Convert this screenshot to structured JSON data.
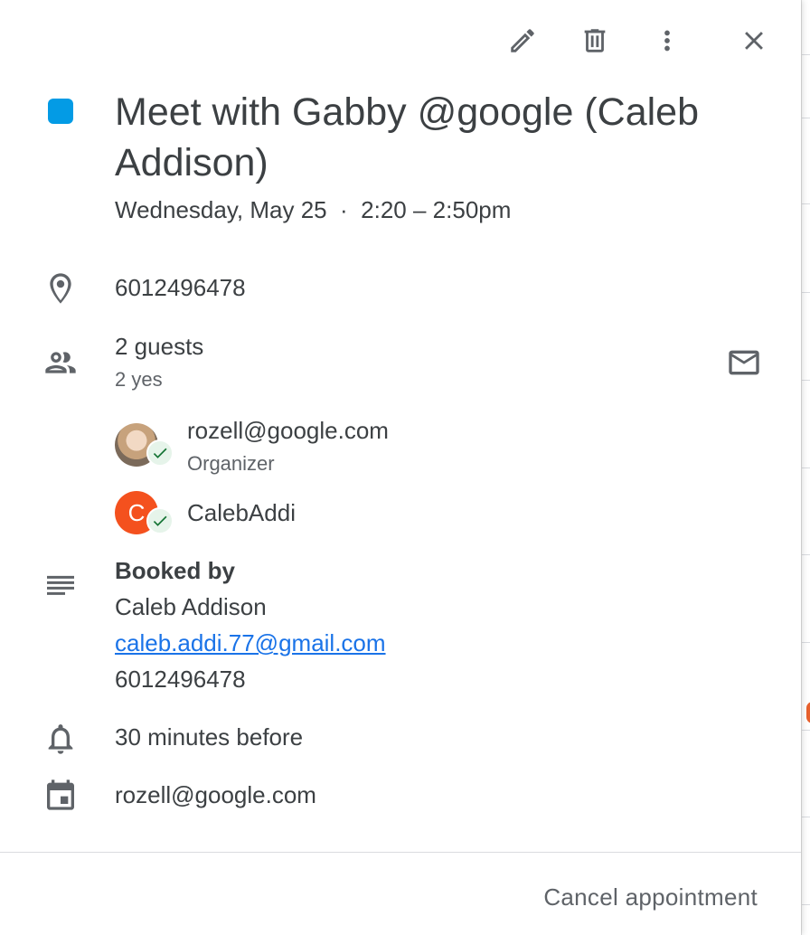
{
  "event": {
    "title": "Meet with Gabby @google (Caleb Addison)",
    "datetime": "Wednesday, May 25  ·  2:20 – 2:50pm",
    "color": "#039be5",
    "location": "6012496478"
  },
  "guests": {
    "summary": "2 guests",
    "responses": "2 yes",
    "list": [
      {
        "name": "rozell@google.com",
        "role": "Organizer",
        "avatar": "photo",
        "status": "accepted"
      },
      {
        "name": "CalebAddi",
        "role": "",
        "avatar": "C",
        "status": "accepted"
      }
    ]
  },
  "description": {
    "heading": "Booked by",
    "name": "Caleb Addison",
    "email": "caleb.addi.77@gmail.com",
    "phone": "6012496478"
  },
  "reminder": "30 minutes before",
  "calendar": "rozell@google.com",
  "actions": {
    "cancel_label": "Cancel appointment"
  },
  "icons": {
    "edit": "pencil-icon",
    "delete": "trash-icon",
    "more": "more-vert-icon",
    "close": "close-icon",
    "location": "location-pin-icon",
    "guests": "people-icon",
    "email": "email-icon",
    "description": "notes-icon",
    "reminder": "bell-icon",
    "calendar": "calendar-icon"
  },
  "colors": {
    "accept_badge": "#137333",
    "avatar_letter_bg": "#f4511e",
    "link": "#1a73e8"
  }
}
